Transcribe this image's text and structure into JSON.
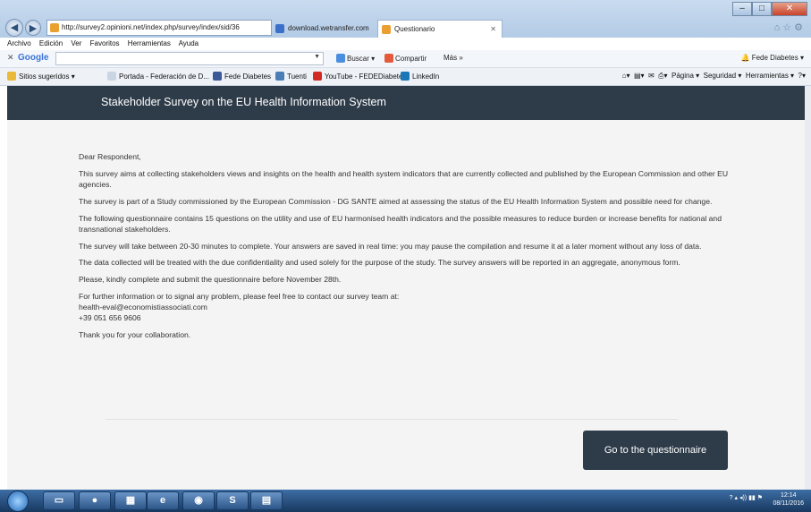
{
  "browser": {
    "address": "http://survey2.opinioni.net/index.php/survey/index/sid/36",
    "tabs": [
      {
        "label": "download.wetransfer.com"
      },
      {
        "label": "Questionario"
      }
    ],
    "menu": [
      "Archivo",
      "Edición",
      "Ver",
      "Favoritos",
      "Herramientas",
      "Ayuda"
    ],
    "toolbar": {
      "logo": "Google",
      "search_button": "Buscar",
      "share_button": "Compartir",
      "more_button": "Más »",
      "account": "Fede Diabetes"
    },
    "favorites": [
      "Sitios sugeridos",
      "Portada - Federación de D...",
      "Fede Diabetes",
      "Tuenti",
      "YouTube - FEDEDiabetes",
      "LinkedIn"
    ],
    "commands": {
      "page": "Página",
      "security": "Seguridad",
      "tools": "Herramientas"
    }
  },
  "page": {
    "header_title": "Stakeholder Survey on the EU Health Information System",
    "greeting": "Dear Respondent,",
    "paragraphs": [
      "This survey aims at collecting stakeholders views and insights on the health and health system indicators that are currently collected and published by the European Commission and other EU agencies.",
      "The survey is part of a Study commissioned by the European Commission - DG SANTE aimed at assessing the status of the EU Health Information System and possible need for change.",
      "The following questionnaire contains 15 questions on the utility and use of EU harmonised health indicators and the possible measures to reduce burden or increase benefits for national and transnational stakeholders.",
      "The survey will take between 20-30 minutes to complete. Your answers are saved in real time: you may pause the compilation and resume it at a later moment without any loss of data.",
      "The data collected will be treated with the due confidentiality and used solely for the purpose of the study. The survey answers will be reported in an aggregate, anonymous form.",
      "Please, kindly complete and submit the questionnaire before November 28th."
    ],
    "contact_intro": "For further information or to signal any problem, please feel free to contact our survey team at:",
    "contact_email": "health-eval@economistiassociati.com",
    "contact_phone": "+39 051 656 9606",
    "thanks": "Thank you for your collaboration.",
    "cta_button": "Go to the questionnaire"
  },
  "taskbar": {
    "time": "12:14",
    "date": "08/11/2016"
  },
  "colors": {
    "header_bg": "#2e3b49",
    "page_bg": "#f4f4f4",
    "button_bg": "#2e3b49"
  }
}
